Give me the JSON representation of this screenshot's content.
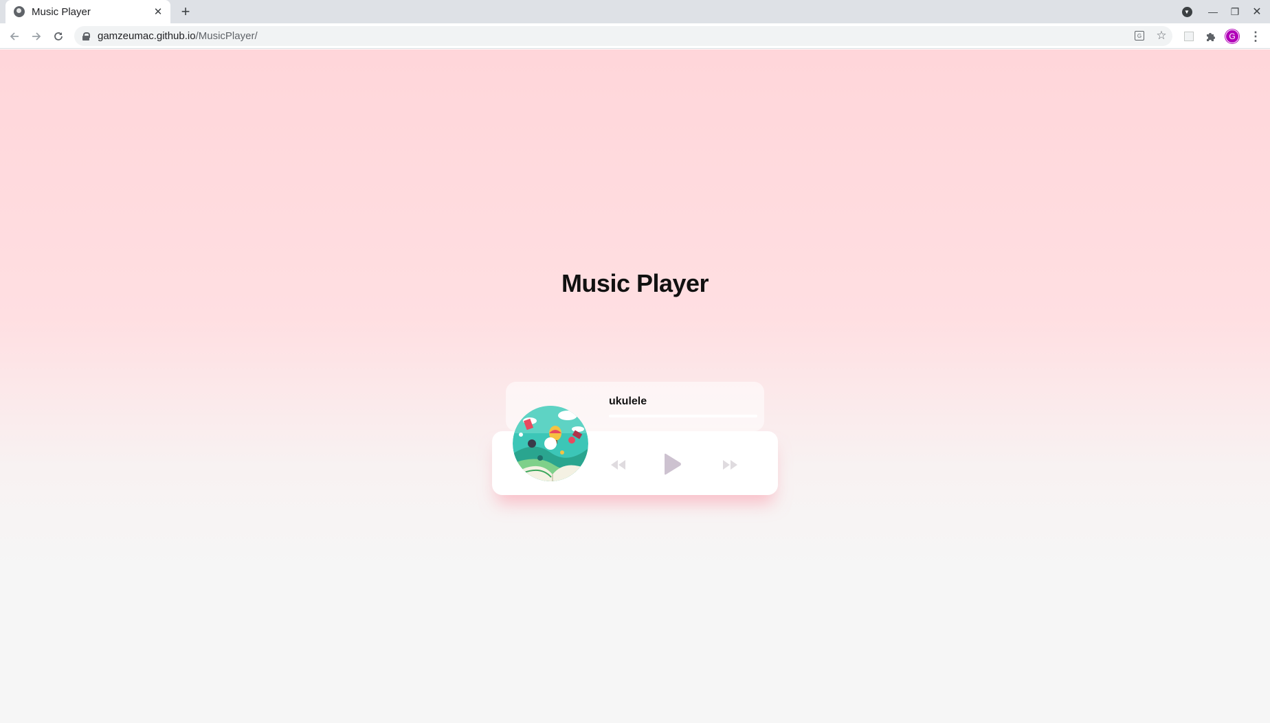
{
  "browser": {
    "tab_title": "Music Player",
    "tab_close": "✕",
    "new_tab": "+",
    "url_host": "gamzeumac.github.io",
    "url_path": "/MusicPlayer/",
    "avatar_letter": "G",
    "icons": {
      "back": "arrow-left-icon",
      "forward": "arrow-right-icon",
      "reload": "reload-icon",
      "lock": "lock-icon",
      "translate": "translate-icon",
      "bookmark": "star-icon",
      "extensions": "puzzle-icon",
      "menu": "kebab-menu-icon"
    }
  },
  "page": {
    "title": "Music Player"
  },
  "player": {
    "song_title": "ukulele",
    "progress_percent": 0,
    "controls": {
      "prev_icon": "backward-icon",
      "play_icon": "play-icon",
      "next_icon": "forward-icon"
    },
    "colors": {
      "accent": "#fe8daa",
      "control_icon": "#dfdbdf",
      "play_icon": "#cdc2d0",
      "page_top": "#ffd6da",
      "page_bottom": "#f6f6f6"
    }
  }
}
